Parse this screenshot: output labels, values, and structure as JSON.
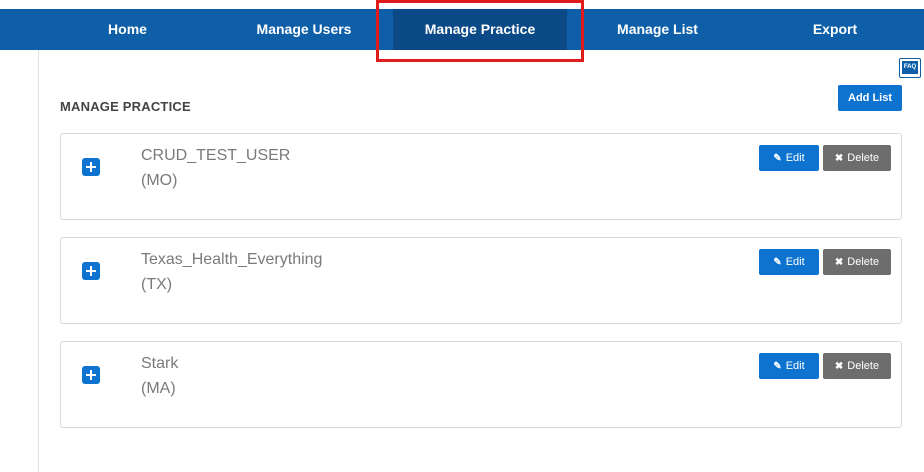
{
  "nav": {
    "items": [
      {
        "label": "Home"
      },
      {
        "label": "Manage Users"
      },
      {
        "label": "Manage Practice",
        "active": true
      },
      {
        "label": "Manage List"
      },
      {
        "label": "Export"
      }
    ]
  },
  "faq": {
    "label": "FAQ"
  },
  "page": {
    "title": "MANAGE PRACTICE",
    "add_list_label": "Add List"
  },
  "practices": [
    {
      "name": "CRUD_TEST_USER",
      "state": "(MO)"
    },
    {
      "name": "Texas_Health_Everything",
      "state": "(TX)"
    },
    {
      "name": "Stark",
      "state": "(MA)"
    }
  ],
  "actions": {
    "edit_label": "Edit",
    "delete_label": "Delete",
    "edit_icon": "edit-icon",
    "delete_icon": "close-icon"
  },
  "colors": {
    "nav_bg": "#0e5fa8",
    "nav_active": "#0b4a86",
    "primary_button": "#0d73cf",
    "delete_button": "#6d6d6d",
    "highlight": "#e01b1b"
  }
}
